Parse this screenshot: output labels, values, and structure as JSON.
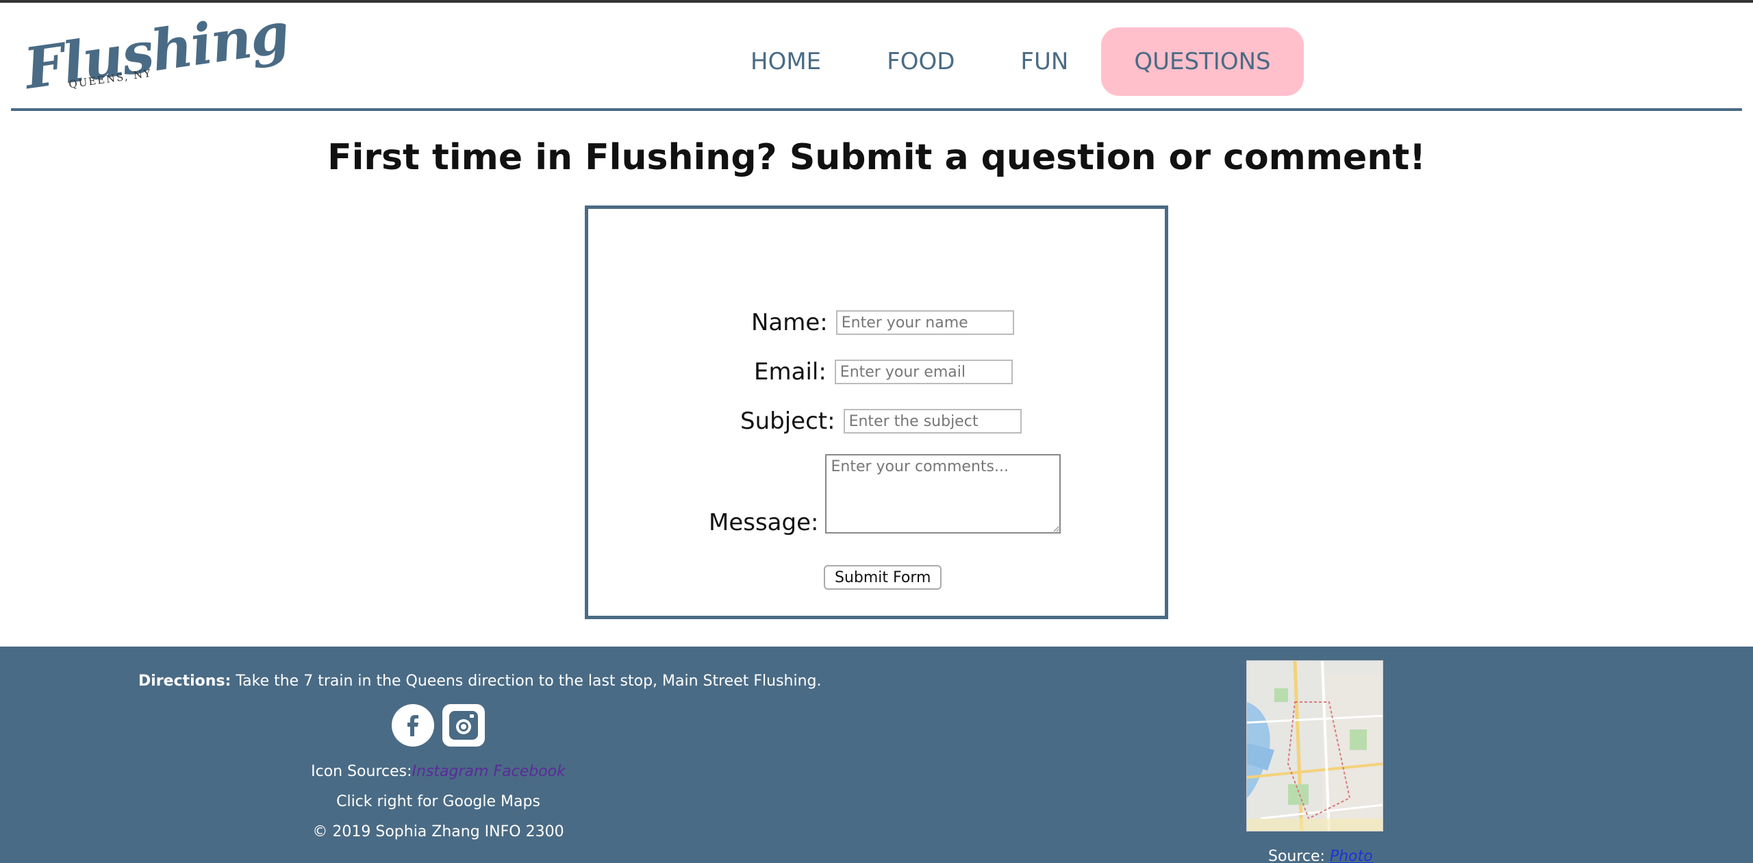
{
  "logo": {
    "script": "Flushing",
    "sub": "QUEENS, NY"
  },
  "nav": {
    "home": "HOME",
    "food": "FOOD",
    "fun": "FUN",
    "questions": "QUESTIONS"
  },
  "heading": "First time in Flushing? Submit a question or comment!",
  "form": {
    "name_label": "Name:",
    "name_placeholder": "Enter your name",
    "email_label": "Email:",
    "email_placeholder": "Enter your email",
    "subject_label": "Subject:",
    "subject_placeholder": "Enter the subject",
    "message_label": "Message:",
    "message_placeholder": "Enter your comments...",
    "submit_label": "Submit Form"
  },
  "footer": {
    "directions_label": "Directions:",
    "directions_text": " Take the 7 train in the Queens direction to the last stop, Main Street Flushing.",
    "icon_sources_label": "Icon Sources:",
    "instagram_link": "Instagram",
    "facebook_link": "Facebook",
    "maps_text": "Click right for Google Maps",
    "copyright": "© 2019 Sophia Zhang INFO 2300",
    "source_label": "Source: ",
    "source_link": "Photo"
  },
  "colors": {
    "accent": "#4a6b85",
    "active_tab": "#ffc0cb",
    "link_visited": "#5b2b9a",
    "link": "#1a35d6"
  },
  "icons": [
    "facebook-icon",
    "instagram-icon"
  ]
}
